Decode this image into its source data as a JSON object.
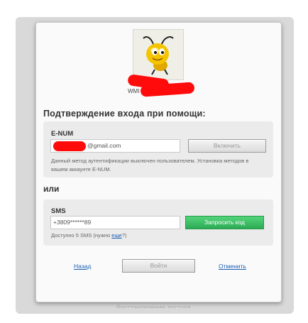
{
  "profile": {
    "wmid_label": "WMI"
  },
  "heading": "Подтверждение входа при помощи:",
  "enum_section": {
    "title": "E-NUM",
    "email_value": "@gmail.com",
    "enable_button": "Включить",
    "note": "Данный метод аутентификации выключен пользователем. Установка методов в вашем аккаунте E-NUM."
  },
  "or_label": "или",
  "sms_section": {
    "title": "SMS",
    "phone_value": "+3809******89",
    "request_button": "Запросить код",
    "available_prefix": "Доступно 5 SMS (нужно ",
    "available_link": "еще",
    "available_suffix": "?)"
  },
  "actions": {
    "back": "Назад",
    "login": "Войти",
    "cancel": "Отменить"
  },
  "footer_text": "Восстановление доступа"
}
